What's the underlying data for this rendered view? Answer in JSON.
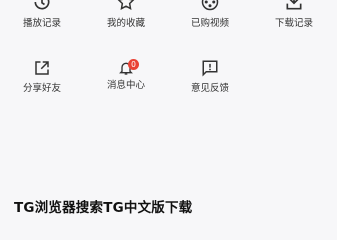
{
  "menu_row_1": [
    {
      "label": "播放记录",
      "icon": "history-icon"
    },
    {
      "label": "我的收藏",
      "icon": "star-icon"
    },
    {
      "label": "已购视频",
      "icon": "film-reel-icon"
    },
    {
      "label": "下载记录",
      "icon": "download-icon"
    }
  ],
  "menu_row_2": [
    {
      "label": "分享好友",
      "icon": "share-icon"
    },
    {
      "label": "消息中心",
      "icon": "bell-icon",
      "badge": "0"
    },
    {
      "label": "意见反馈",
      "icon": "feedback-icon"
    }
  ],
  "headline": "TG浏览器搜索TG中文版下载",
  "colors": {
    "badge": "#e94235",
    "icon": "#333333",
    "background": "#f7f7f9"
  }
}
